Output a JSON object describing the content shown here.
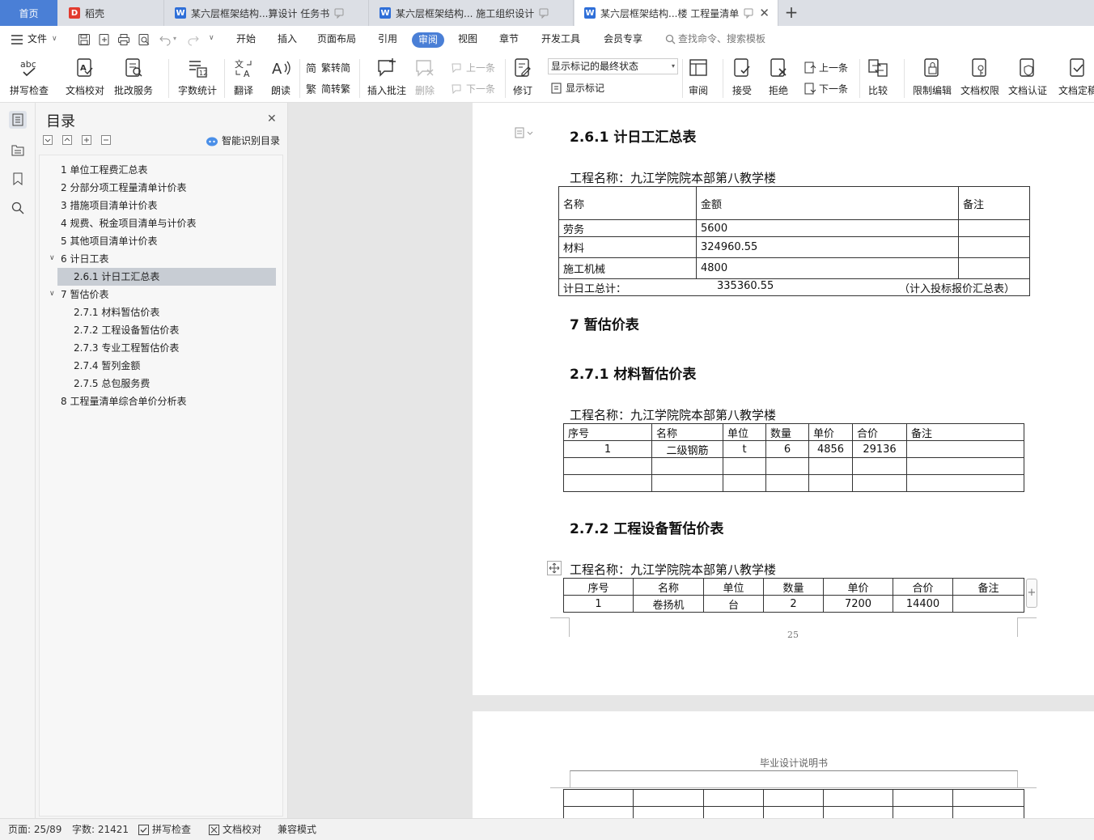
{
  "tabs": {
    "home": "首页",
    "t1": "稻壳",
    "t2": "某六层框架结构...算设计 任务书",
    "t3": "某六层框架结构... 施工组织设计",
    "t4": "某六层框架结构...楼 工程量清单",
    "new_tab": "+"
  },
  "menu": {
    "file": "文件",
    "items": [
      "开始",
      "插入",
      "页面布局",
      "引用",
      "审阅",
      "视图",
      "章节",
      "开发工具",
      "会员专享"
    ],
    "search": "查找命令、搜索模板"
  },
  "ribbon": {
    "spell": "拼写检查",
    "doccheck": "文档校对",
    "review_service": "批改服务",
    "wordcount": "字数统计",
    "translate": "翻译",
    "read": "朗读",
    "t2s": "繁转简",
    "s2t": "简转繁",
    "insert_comment": "插入批注",
    "delete": "删除",
    "prev_comment": "上一条",
    "next_comment": "下一条",
    "track": "修订",
    "markup_state": "显示标记的最终状态",
    "show_markup": "显示标记",
    "review": "审阅",
    "accept": "接受",
    "reject": "拒绝",
    "prev_change": "上一条",
    "next_change": "下一条",
    "compare": "比较",
    "restrict": "限制编辑",
    "permission": "文档权限",
    "certify": "文档认证",
    "finalize": "文档定稿"
  },
  "toc": {
    "title": "目录",
    "smart": "智能识别目录",
    "items": [
      "1 单位工程费汇总表",
      "2 分部分项工程量清单计价表",
      "3 措施项目清单计价表",
      "4 规费、税金项目清单与计价表",
      "5 其他项目清单计价表",
      "6 计日工表",
      "2.6.1 计日工汇总表",
      "7 暂估价表",
      "2.7.1  材料暂估价表",
      "2.7.2 工程设备暂估价表",
      "2.7.3 专业工程暂估价表",
      "2.7.4 暂列金额",
      "2.7.5 总包服务费",
      "8 工程量清单综合单价分析表"
    ]
  },
  "doc": {
    "h261": "2.6.1 计日工汇总表",
    "project_label": "工程名称：九江学院院本部第八教学楼",
    "t1_head": [
      "名称",
      "金额",
      "备注"
    ],
    "t1_rows": [
      [
        "劳务",
        "5600",
        ""
      ],
      [
        "材料",
        "324960.55",
        ""
      ],
      [
        "施工机械",
        "4800",
        ""
      ]
    ],
    "t1_total_label": "计日工总计：",
    "t1_total_value": "335360.55",
    "t1_total_note": "（计入投标报价汇总表）",
    "h7": "7 暂估价表",
    "h271": "2.7.1  材料暂估价表",
    "t2_head": [
      "序号",
      "名称",
      "单位",
      "数量",
      "单价",
      "合价",
      "备注"
    ],
    "t2_rows": [
      [
        "1",
        "二级钢筋",
        "t",
        "6",
        "4856",
        "29136",
        ""
      ],
      [
        "",
        "",
        "",
        "",
        "",
        "",
        ""
      ],
      [
        "",
        "",
        "",
        "",
        "",
        "",
        ""
      ]
    ],
    "h272": "2.7.2 工程设备暂估价表",
    "t3_head": [
      "序号",
      "名称",
      "单位",
      "数量",
      "单价",
      "合价",
      "备注"
    ],
    "t3_rows": [
      [
        "1",
        "卷扬机",
        "台",
        "2",
        "7200",
        "14400",
        ""
      ]
    ],
    "page_number": "25",
    "next_header": "毕业设计说明书"
  },
  "status": {
    "page": "页面: 25/89",
    "words": "字数: 21421",
    "spell": "拼写检查",
    "doccheck": "文档校对",
    "compat": "兼容模式"
  }
}
